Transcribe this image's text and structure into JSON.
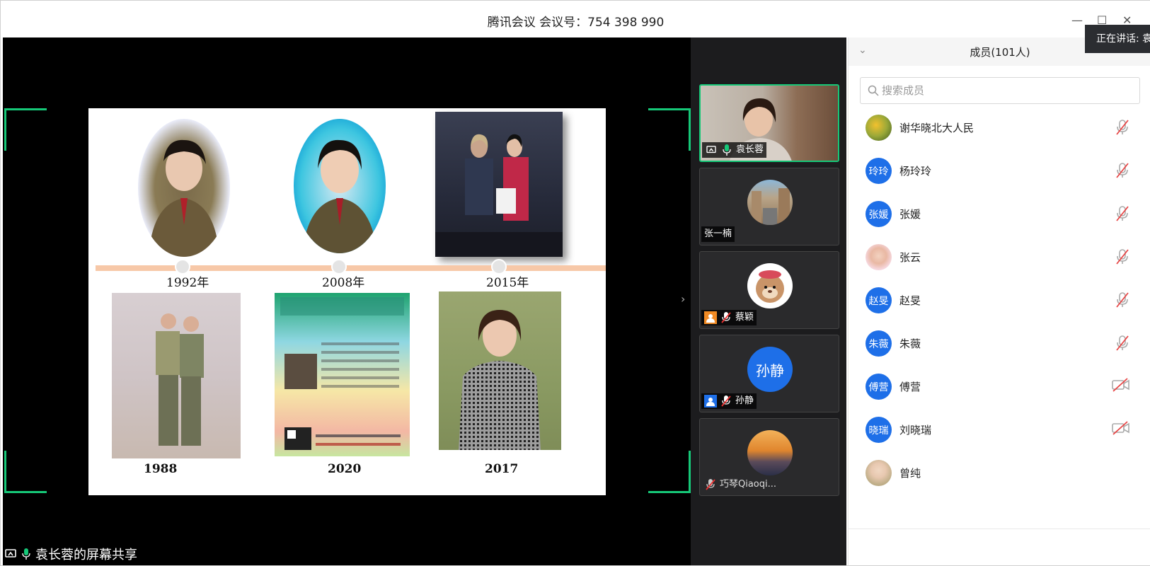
{
  "window": {
    "title": "腾讯会议 会议号：754 398 990",
    "speaking_label": "正在讲话: 袁"
  },
  "share": {
    "label": "袁长蓉的屏幕共享",
    "slide": {
      "years_top": [
        "1992年",
        "2008年",
        "2015年"
      ],
      "years_bottom": [
        "1988",
        "2020",
        "2017"
      ]
    }
  },
  "video_tiles": [
    {
      "name": "袁长蓉",
      "mic": "on",
      "active": true,
      "icon": "screen-share-icon"
    },
    {
      "name": "张一楠",
      "mic": "none",
      "active": false
    },
    {
      "name": "蔡颖",
      "mic": "muted",
      "active": false,
      "icon": "user-icon"
    },
    {
      "name": "孙静",
      "mic": "muted",
      "active": false,
      "icon": "user-icon",
      "avatar_text": "孙静"
    },
    {
      "name": "巧琴Qiaoqi...",
      "mic": "muted",
      "active": false
    }
  ],
  "members": {
    "title": "成员(101人)",
    "search_placeholder": "搜索成员",
    "list": [
      {
        "name": "谢华晓北大人民",
        "avatar": "image",
        "status": "mic-muted"
      },
      {
        "name": "杨玲玲",
        "avatar_text": "玲玲",
        "status": "mic-muted"
      },
      {
        "name": "张媛",
        "avatar_text": "张媛",
        "status": "mic-muted"
      },
      {
        "name": "张云",
        "avatar": "image",
        "status": "mic-muted"
      },
      {
        "name": "赵旻",
        "avatar_text": "赵旻",
        "status": "mic-muted"
      },
      {
        "name": "朱薇",
        "avatar_text": "朱薇",
        "status": "mic-muted"
      },
      {
        "name": "傅营",
        "avatar_text": "傅营",
        "status": "video-off"
      },
      {
        "name": "刘晓瑞",
        "avatar_text": "晓瑞",
        "status": "video-off"
      },
      {
        "name": "曾纯",
        "avatar": "image",
        "status": "none"
      }
    ]
  },
  "colors": {
    "accent_green": "#16c878",
    "avatar_blue": "#1e6fe8",
    "timeline": "#f7c8a8",
    "panel_dark": "#1c1c1e"
  }
}
